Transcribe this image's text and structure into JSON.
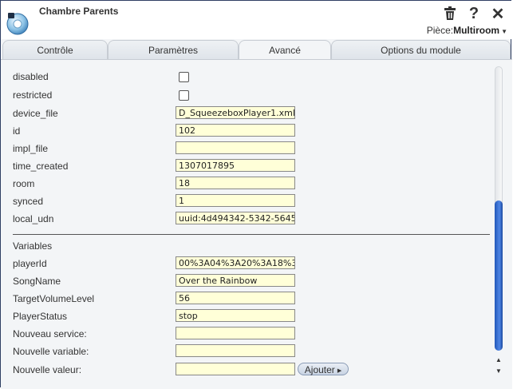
{
  "header": {
    "title": "Chambre Parents",
    "room_label": "Pièce:",
    "room_value": "Multiroom",
    "icons": [
      "trash-icon",
      "help-icon",
      "close-icon"
    ]
  },
  "tabs": [
    {
      "label": "Contrôle"
    },
    {
      "label": "Paramètres"
    },
    {
      "label": "Avancé",
      "active": true
    },
    {
      "label": "Options du module"
    }
  ],
  "attributes": {
    "disabled": {
      "label": "disabled",
      "checked": false
    },
    "restricted": {
      "label": "restricted",
      "checked": false
    },
    "device_file": {
      "label": "device_file",
      "value": "D_SqueezeboxPlayer1.xml"
    },
    "id": {
      "label": "id",
      "value": "102"
    },
    "impl_file": {
      "label": "impl_file",
      "value": ""
    },
    "time_created": {
      "label": "time_created",
      "value": "1307017895"
    },
    "room": {
      "label": "room",
      "value": "18"
    },
    "synced": {
      "label": "synced",
      "value": "1"
    },
    "local_udn": {
      "label": "local_udn",
      "value": "uuid:4d494342-5342-5645"
    }
  },
  "variables": {
    "heading": "Variables",
    "playerId": {
      "label": "playerId",
      "value": "00%3A04%3A20%3A18%3A0"
    },
    "SongName": {
      "label": "SongName",
      "value": "Over the Rainbow"
    },
    "TargetVolumeLevel": {
      "label": "TargetVolumeLevel",
      "value": "56"
    },
    "PlayerStatus": {
      "label": "PlayerStatus",
      "value": "stop"
    },
    "new_service": {
      "label": "Nouveau service:",
      "value": ""
    },
    "new_variable": {
      "label": "Nouvelle variable:",
      "value": ""
    },
    "new_value": {
      "label": "Nouvelle valeur:",
      "value": ""
    },
    "add_button": "Ajouter"
  },
  "colors": {
    "accent": "#2f5fc4",
    "field_bg": "#ffffd8",
    "frame": "#2f3f63"
  }
}
